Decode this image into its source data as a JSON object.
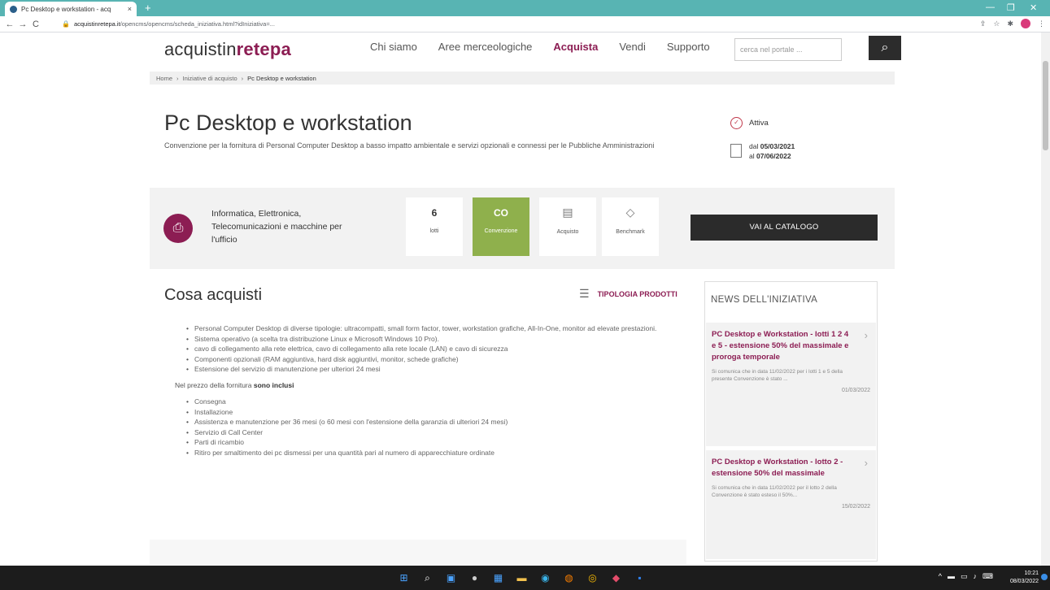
{
  "browser": {
    "tab_title": "Pc Desktop e workstation - acq",
    "url_host": "acquistinretepa.it",
    "url_path": "/opencms/opencms/scheda_iniziativa.html?idIniziativa=...",
    "tab_close": "×",
    "new_tab": "+",
    "back": "←",
    "forward": "→",
    "reload": "C",
    "lock": "🔒",
    "min": "—",
    "restore": "❐",
    "close": "✕"
  },
  "site": {
    "logo_pre": "acquistin",
    "logo_mid": "rete",
    "logo_post": "pa",
    "nav": [
      "Chi siamo",
      "Aree merceologiche",
      "Acquista",
      "Vendi",
      "Supporto"
    ],
    "search_placeholder": "cerca nel portale ...",
    "search_icon": "⌕"
  },
  "breadcrumb": [
    "Home",
    "›",
    "Iniziative di acquisto",
    "›",
    "Pc Desktop e workstation"
  ],
  "page": {
    "title": "Pc Desktop e workstation",
    "subtitle": "Convenzione per la fornitura di Personal Computer Desktop a basso impatto ambientale e servizi opzionali e connessi per le Pubbliche Amministrazioni",
    "status": "Attiva",
    "date_from_prefix": "dal",
    "date_from": "05/03/2021",
    "date_to_prefix": "al",
    "date_to": "07/06/2022"
  },
  "category": {
    "name": "Informatica, Elettronica, Telecomunicazioni e macchine per l'ufficio",
    "icon": "printer-icon"
  },
  "stats": {
    "lotti_value": "6",
    "lotti_label": "lotti",
    "strumento_value": "CO",
    "strumento_label": "Convenzione",
    "acquisto_label": "Acquisto",
    "benchmark_label": "Benchmark"
  },
  "catalog_button": "VAI AL CATALOGO",
  "cosa": {
    "title": "Cosa acquisti",
    "tipologia": "TIPOLOGIA PRODOTTI",
    "items": [
      "Personal Computer Desktop di diverse tipologie: ultracompatti, small form factor, tower, workstation grafiche, All-In-One, monitor ad elevate prestazioni.",
      "Sistema operativo (a scelta tra distribuzione Linux e Microsoft Windows 10 Pro).",
      "cavo di collegamento alla rete elettrica, cavo di collegamento alla rete locale (LAN) e cavo di sicurezza",
      "Componenti opzionali (RAM aggiuntiva, hard disk aggiuntivi, monitor, schede grafiche)",
      "Estensione del servizio di manutenzione per ulteriori 24 mesi"
    ],
    "included_intro": "Nel prezzo della fornitura",
    "included_bold": "sono inclusi",
    "included": [
      "Consegna",
      "Installazione",
      "Assistenza e manutenzione per 36 mesi (o 60 mesi con l'estensione della garanzia di ulteriori 24 mesi)",
      "Servizio di Call Center",
      "Parti di ricambio",
      "Ritiro per smaltimento dei pc dismessi per una quantità pari al numero di apparecchiature ordinate"
    ]
  },
  "news": {
    "header": "NEWS DELL'INIZIATIVA",
    "items": [
      {
        "title": "PC Desktop e Workstation - lotti 1 2 4 e 5 - estensione 50% del massimale e proroga temporale",
        "desc": "Si comunica che in data 11/02/2022 per i lotti 1 e 5 della presente Convenzione è stato ...",
        "date": "01/03/2022"
      },
      {
        "title": "PC Desktop e Workstation - lotto 2 - estensione 50% del massimale",
        "desc": "Si comunica che in data 11/02/2022 per il lotto 2 della Convenzione è stato esteso il 50%...",
        "date": "15/02/2022"
      }
    ]
  },
  "taskbar": {
    "time": "10:21",
    "date": "08/03/2022"
  },
  "colors": {
    "brand": "#8c1d53",
    "green": "#8fb04c",
    "dark": "#2b2b2b",
    "chrome": "#58b4b3"
  }
}
